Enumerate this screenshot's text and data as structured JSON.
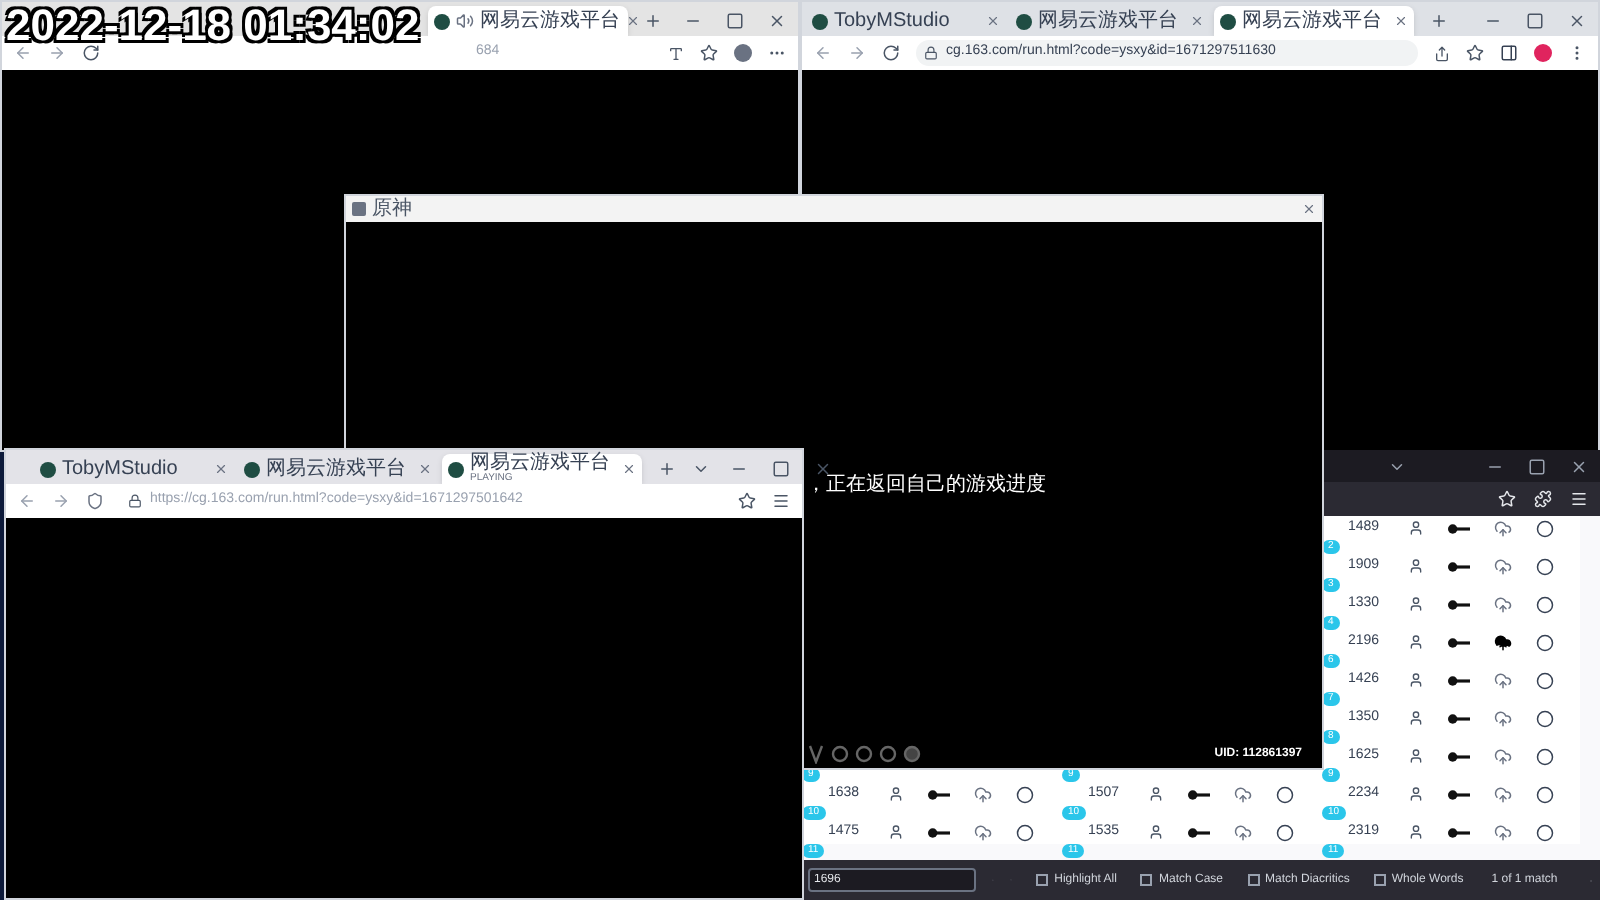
{
  "timestamp": "2022-12-18 01:34:02",
  "windows": [
    {
      "kind": "edge",
      "tabs": [
        {
          "title": "网易云游戏平台",
          "selected": true,
          "audio": true
        }
      ],
      "url": "684"
    },
    {
      "kind": "chrome",
      "tabs": [
        {
          "title": "TobyMStudio",
          "selected": false,
          "audio": false
        },
        {
          "title": "网易云游戏平台",
          "selected": false,
          "audio": false
        },
        {
          "title": "网易云游戏平台",
          "selected": true,
          "audio": false
        }
      ],
      "url": "cg.163.com/run.html?code=ysxy&id=1671297511630"
    },
    {
      "kind": "list",
      "columns": [
        {
          "rows": [
            {
              "badge": "9",
              "number": "1638",
              "downloaded": false
            },
            {
              "badge": "10",
              "number": "1475",
              "downloaded": false
            }
          ],
          "next_badge": "11"
        },
        {
          "rows": [
            {
              "badge": "9",
              "number": "1507",
              "downloaded": false
            },
            {
              "badge": "10",
              "number": "1535",
              "downloaded": false
            }
          ],
          "next_badge": "11"
        },
        {
          "rows": [
            {
              "number": "1489",
              "downloaded": false
            },
            {
              "badge": "2",
              "number": "1909",
              "downloaded": false
            },
            {
              "badge": "3",
              "number": "1330",
              "downloaded": false
            },
            {
              "badge": "4",
              "number": "2196",
              "downloaded": true
            },
            {
              "badge": "6",
              "number": "1426",
              "downloaded": false
            },
            {
              "badge": "7",
              "number": "1350",
              "downloaded": false
            },
            {
              "badge": "8",
              "number": "1625",
              "downloaded": false
            },
            {
              "badge": "9",
              "number": "2234",
              "downloaded": false
            },
            {
              "badge": "10",
              "number": "2319",
              "downloaded": false
            }
          ],
          "next_badge": "11"
        }
      ],
      "find_bar": {
        "query": "1696",
        "options": [
          {
            "label": "Highlight All",
            "checked": false
          },
          {
            "label": "Match Case",
            "checked": false
          },
          {
            "label": "Match Diacritics",
            "checked": false
          },
          {
            "label": "Whole Words",
            "checked": false
          }
        ],
        "status": "1 of 1 match"
      }
    },
    {
      "kind": "game",
      "title": "原神",
      "message": "，正在返回自己的游戏进度",
      "uid": "UID: 112861397"
    },
    {
      "kind": "firefox",
      "tabs": [
        {
          "title": "TobyMStudio",
          "selected": false,
          "audio": false
        },
        {
          "title": "网易云游戏平台",
          "selected": false,
          "audio": false
        },
        {
          "title": "网易云游戏平台",
          "subtitle": "PLAYING",
          "selected": true,
          "audio": false
        }
      ],
      "url": "https://cg.163.com/run.html?code=ysxy&id=1671297501642"
    }
  ]
}
